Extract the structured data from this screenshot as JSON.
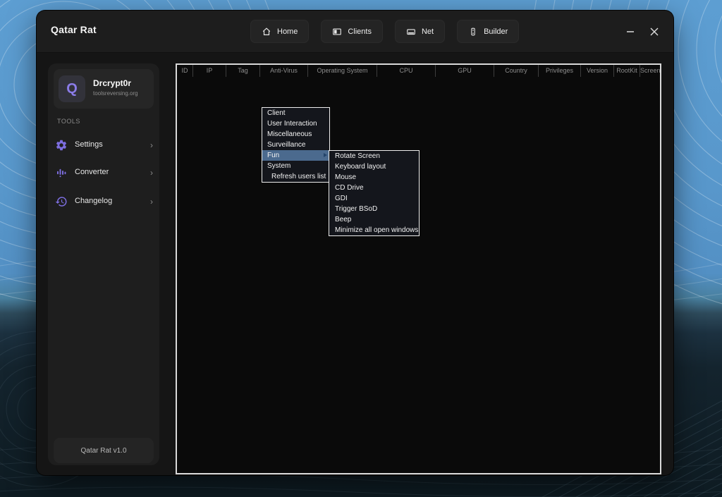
{
  "window": {
    "title": "Qatar Rat"
  },
  "nav": {
    "items": [
      {
        "label": "Home",
        "icon": "home-icon"
      },
      {
        "label": "Clients",
        "icon": "clients-icon"
      },
      {
        "label": "Net",
        "icon": "net-icon"
      },
      {
        "label": "Builder",
        "icon": "builder-icon"
      }
    ]
  },
  "sidebar": {
    "profile": {
      "avatar_letter": "Q",
      "name": "Drcrypt0r",
      "subtitle": "toolsreversing.org"
    },
    "section_label": "TOOLS",
    "items": [
      {
        "label": "Settings",
        "icon": "gear-icon"
      },
      {
        "label": "Converter",
        "icon": "equalizer-icon"
      },
      {
        "label": "Changelog",
        "icon": "history-icon"
      }
    ],
    "footer": "Qatar Rat v1.0"
  },
  "clients_table": {
    "columns": [
      "ID",
      "IP",
      "Tag",
      "Anti-Virus",
      "Operating System",
      "CPU",
      "GPU",
      "Country",
      "Privileges",
      "Version",
      "RootKit",
      "Screen"
    ],
    "rows": []
  },
  "context_menu": {
    "items": [
      {
        "label": "Client",
        "has_submenu": false,
        "highlighted": false
      },
      {
        "label": "User Interaction",
        "has_submenu": false,
        "highlighted": false
      },
      {
        "label": "Miscellaneous",
        "has_submenu": false,
        "highlighted": false
      },
      {
        "label": "Surveillance",
        "has_submenu": false,
        "highlighted": false
      },
      {
        "label": "Fun",
        "has_submenu": true,
        "highlighted": true
      },
      {
        "label": "System",
        "has_submenu": false,
        "highlighted": false
      },
      {
        "label": "Refresh users list",
        "has_submenu": false,
        "highlighted": false
      }
    ]
  },
  "fun_submenu": {
    "items": [
      "Rotate Screen",
      "Keyboard layout",
      "Mouse",
      "CD Drive",
      "GDI",
      "Trigger BSoD",
      "Beep",
      "Minimize all open windows"
    ]
  },
  "colors": {
    "accent_purple": "#7d6ee0",
    "menu_highlight": "#4b6a8e",
    "wallpaper_blue": "#5897cb",
    "window_bg": "#151515"
  }
}
